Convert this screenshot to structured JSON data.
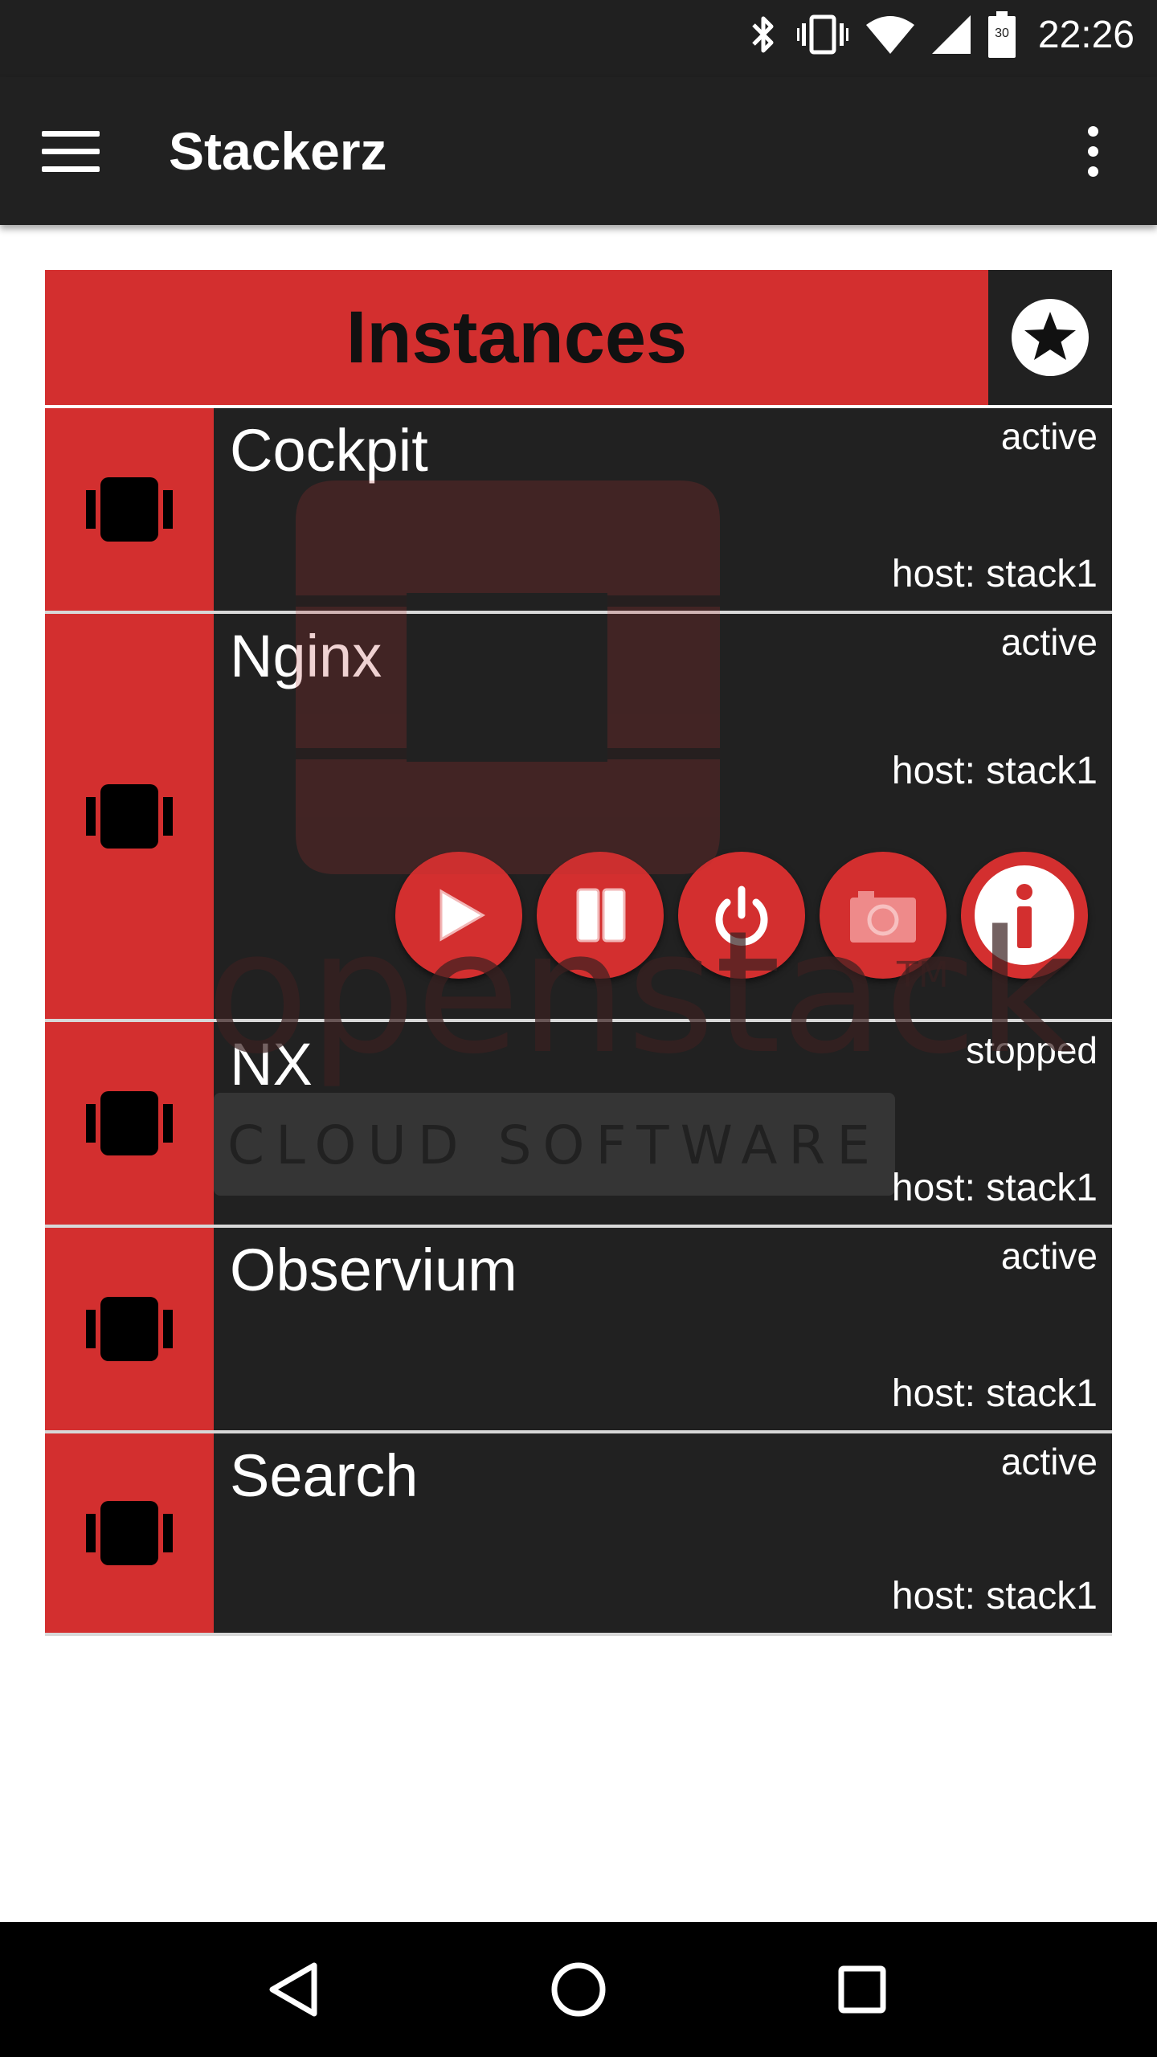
{
  "status_bar": {
    "time": "22:26",
    "battery_level": "30",
    "icons": [
      "bluetooth-icon",
      "vibrate-icon",
      "wifi-icon",
      "signal-icon",
      "battery-icon"
    ]
  },
  "app_bar": {
    "title": "Stackerz",
    "menu_icon": "hamburger-menu-icon",
    "overflow_icon": "more-vert-icon"
  },
  "header": {
    "title": "Instances",
    "favorite_icon": "star-icon"
  },
  "watermark": {
    "brand": "openstack",
    "tagline": "CLOUD SOFTWARE",
    "trademark": "TM"
  },
  "instances": [
    {
      "name": "Cockpit",
      "status": "active",
      "host": "host: stack1",
      "expanded": false
    },
    {
      "name": "Nginx",
      "status": "active",
      "host": "host: stack1",
      "expanded": true
    },
    {
      "name": "NX",
      "status": "stopped",
      "host": "host: stack1",
      "expanded": false
    },
    {
      "name": "Observium",
      "status": "active",
      "host": "host: stack1",
      "expanded": false
    },
    {
      "name": "Search",
      "status": "active",
      "host": "host: stack1",
      "expanded": false
    }
  ],
  "actions": [
    "play-icon",
    "pause-icon",
    "power-icon",
    "camera-icon",
    "info-icon"
  ],
  "colors": {
    "accent_red": "#d32f2f",
    "dark_surface": "#212121",
    "status_bar": "#202020"
  },
  "nav_bar": {
    "icons": [
      "back-icon",
      "home-icon",
      "recents-icon"
    ]
  }
}
